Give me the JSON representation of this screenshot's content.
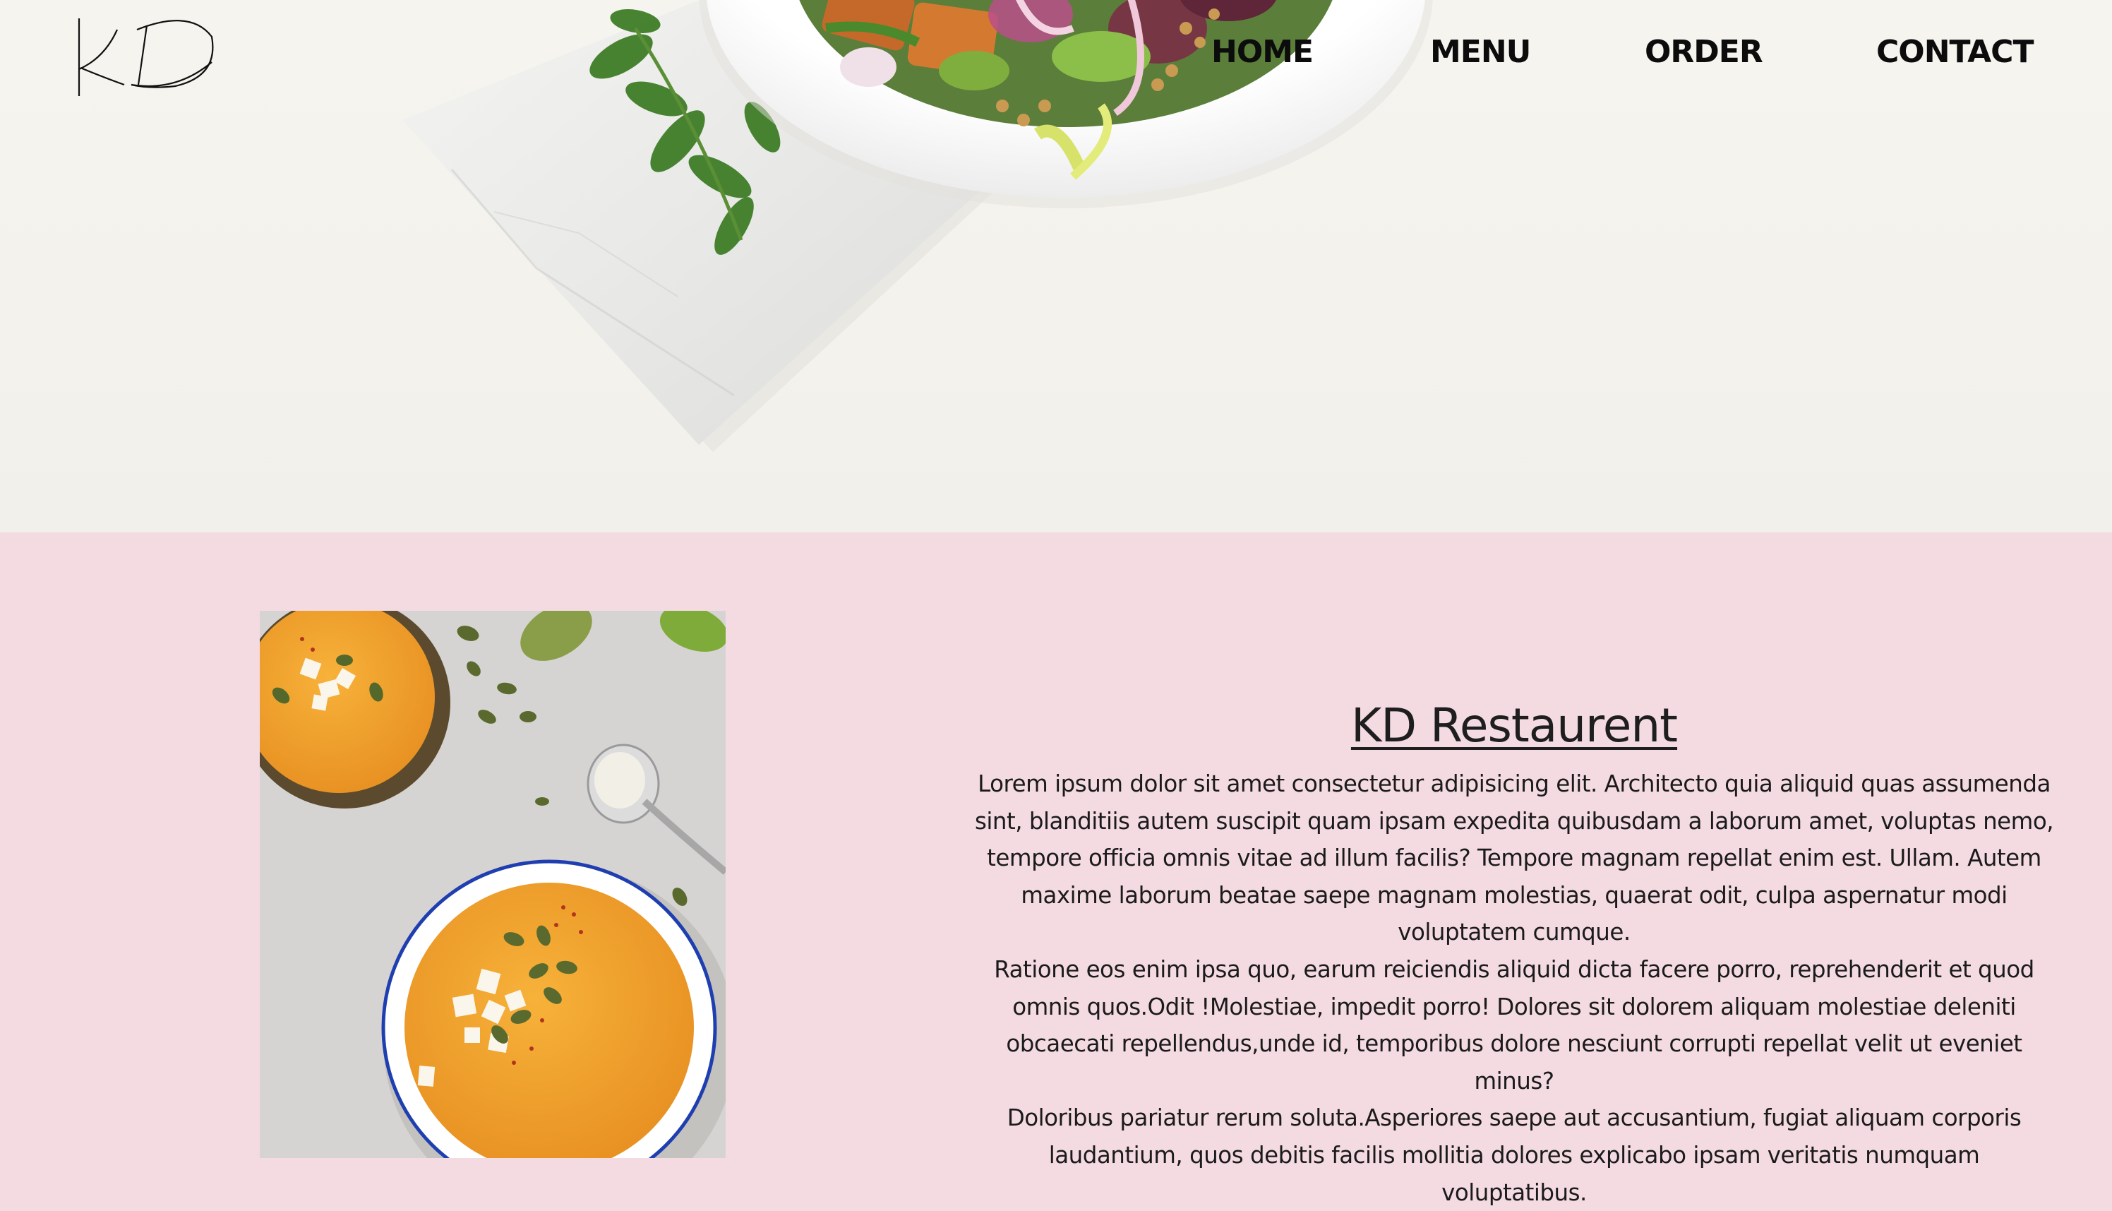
{
  "brand": {
    "logo_text": "KD"
  },
  "nav": {
    "items": [
      {
        "label": "HOME"
      },
      {
        "label": "MENU"
      },
      {
        "label": "ORDER"
      },
      {
        "label": "CONTACT"
      }
    ]
  },
  "about": {
    "title": "KD Restaurent",
    "paragraphs": [
      "Lorem ipsum dolor sit amet consectetur adipisicing elit. Architecto quia aliquid quas assumenda sint, blanditiis autem suscipit quam ipsam expedita quibusdam a laborum amet, voluptas nemo, tempore officia omnis vitae ad illum facilis? Tempore magnam repellat enim est. Ullam. Autem maxime laborum beatae saepe magnam molestias, quaerat odit, culpa aspernatur modi voluptatem cumque.",
      "Ratione eos enim ipsa quo, earum reiciendis aliquid dicta facere porro, reprehenderit et quod omnis quos.Odit !Molestiae, impedit porro! Dolores sit dolorem aliquam molestiae deleniti obcaecati repellendus,unde id, temporibus dolore nesciunt corrupti repellat velit ut eveniet minus?",
      "Doloribus pariatur rerum soluta.Asperiores saepe aut accusantium, fugiat aliquam corporis laudantium, quos debitis facilis mollitia dolores explicabo ipsam veritatis numquam voluptatibus."
    ]
  },
  "colors": {
    "section_bg": "#f4dbe2",
    "hero_bg": "#f5f3ee",
    "nav_text": "#0c0c0c",
    "body_text": "#1b1b1b",
    "soup_orange": "#f0a030",
    "bowl_rim": "#1f3fb0"
  }
}
